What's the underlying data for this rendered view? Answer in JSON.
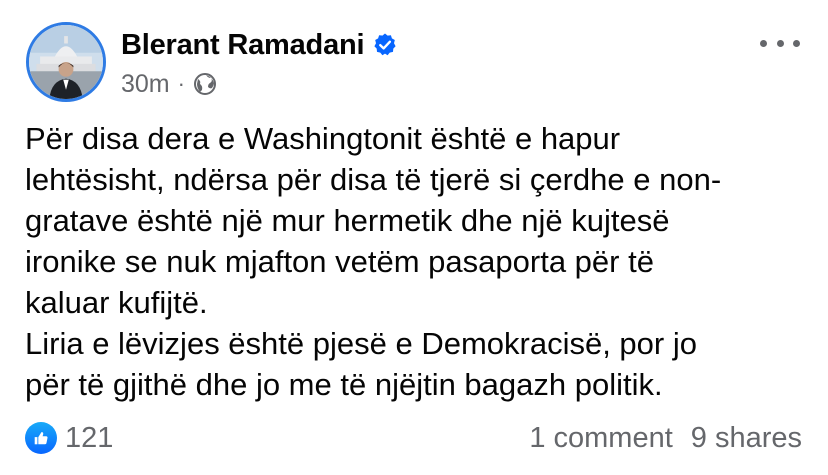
{
  "post": {
    "author": "Blerant Ramadani",
    "verified_icon": "verified-badge-icon",
    "timestamp": "30m",
    "separator": "·",
    "audience_icon": "globe-icon",
    "body": "Për disa dera e Washingtonit është e hapur\nlehtësisht, ndërsa për disa të tjerë si çerdhe e non-\ngratave është një mur hermetik dhe një kujtesë\nironike se nuk mjafton vetëm pasaporta për të\nkaluar kufijtë.\nLiria e lëvizjes është pjesë e Demokracisë, por jo\npër të gjithë dhe jo me të njëjtin bagazh politik."
  },
  "footer": {
    "reaction_icon": "like-icon",
    "reaction_count": "121",
    "comments": "1 comment",
    "shares": "9 shares"
  },
  "colors": {
    "accent": "#0866ff",
    "secondary_text": "#65676b",
    "primary_text": "#050505"
  }
}
